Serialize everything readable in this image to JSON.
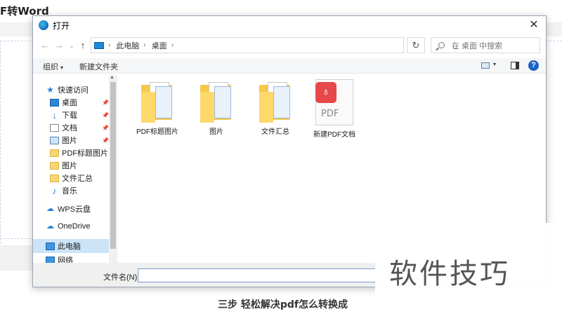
{
  "background": {
    "title": "F转Word",
    "bottom_text": "三步 轻松解决pdf怎么转换成"
  },
  "dialog": {
    "title": "打开",
    "close": "✕",
    "address": {
      "back": "←",
      "forward": "→",
      "recent": "⌄",
      "up": "↑",
      "crumbs": [
        "此电脑",
        "桌面"
      ],
      "separator": "›",
      "dropdown": "⌄",
      "refresh": "↻",
      "search_placeholder": "在 桌面 中搜索"
    },
    "toolbar": {
      "organize": "组织",
      "new_folder": "新建文件夹",
      "caret": "▾",
      "help": "?"
    },
    "nav": [
      {
        "label": "快速访问",
        "icon": "star-icon"
      },
      {
        "label": "桌面",
        "icon": "desktop-icon",
        "pinned": true
      },
      {
        "label": "下载",
        "icon": "download-icon",
        "pinned": true
      },
      {
        "label": "文档",
        "icon": "document-icon",
        "pinned": true
      },
      {
        "label": "图片",
        "icon": "picture-icon",
        "pinned": true
      },
      {
        "label": "PDF标题图片",
        "icon": "folder-icon"
      },
      {
        "label": "图片",
        "icon": "folder-icon"
      },
      {
        "label": "文件汇总",
        "icon": "folder-icon"
      },
      {
        "label": "音乐",
        "icon": "music-icon"
      },
      {
        "label": "WPS云盘",
        "icon": "cloud-icon"
      },
      {
        "label": "OneDrive",
        "icon": "onedrive-icon"
      },
      {
        "label": "此电脑",
        "icon": "pc-icon",
        "selected": true
      },
      {
        "label": "网络",
        "icon": "network-icon"
      }
    ],
    "files": [
      {
        "name": "PDF标题图片",
        "type": "folder"
      },
      {
        "name": "图片",
        "type": "folder"
      },
      {
        "name": "文件汇总",
        "type": "folder"
      },
      {
        "name": "新建PDF文档",
        "type": "pdf",
        "badge_text": "PDF"
      }
    ],
    "footer": {
      "filename_label": "文件名(N):",
      "filename_value": ""
    }
  },
  "watermark": "软件技巧"
}
